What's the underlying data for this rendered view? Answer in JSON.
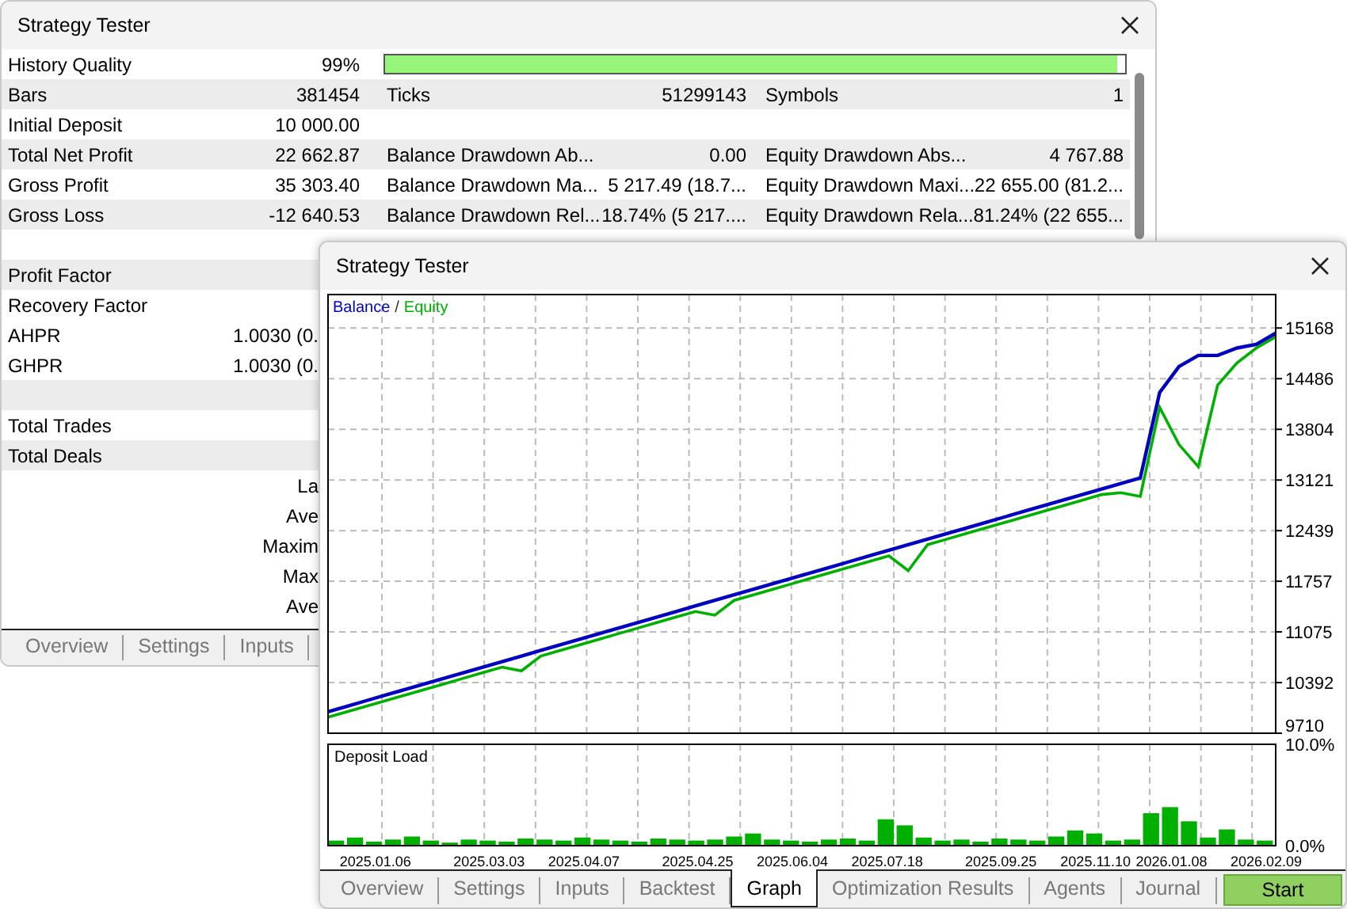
{
  "back_window": {
    "title": "Strategy Tester",
    "rows": [
      {
        "kind": "quality",
        "label": "History Quality",
        "value": "99%",
        "level": 0.99
      },
      {
        "kind": "full",
        "label": "Bars",
        "value": "381454",
        "label2": "Ticks",
        "value2": "51299143",
        "label3": "Symbols",
        "value3": "1"
      },
      {
        "kind": "full",
        "label": "Initial Deposit",
        "value": "10 000.00"
      },
      {
        "kind": "full",
        "label": "Total Net Profit",
        "value": "22 662.87",
        "label2": "Balance Drawdown Ab...",
        "value2": "0.00",
        "label3": "Equity Drawdown Abs...",
        "value3": "4 767.88"
      },
      {
        "kind": "full",
        "label": "Gross Profit",
        "value": "35 303.40",
        "label2": "Balance Drawdown Ma...",
        "value2": "5 217.49 (18.7...",
        "label3": "Equity Drawdown Maxi...",
        "value3": "22 655.00 (81.2..."
      },
      {
        "kind": "full",
        "label": "Gross Loss",
        "value": "-12 640.53",
        "label2": "Balance Drawdown Rel...",
        "value2": "18.74% (5 217....",
        "label3": "Equity Drawdown Rela...",
        "value3": "81.24% (22 655..."
      },
      {
        "kind": "blank"
      },
      {
        "kind": "full",
        "label": "Profit Factor"
      },
      {
        "kind": "full",
        "label": "Recovery Factor"
      },
      {
        "kind": "partial",
        "label": "AHPR",
        "value": "1.0030 (0."
      },
      {
        "kind": "partial",
        "label": "GHPR",
        "value": "1.0030 (0."
      },
      {
        "kind": "blank"
      },
      {
        "kind": "full",
        "label": "Total Trades"
      },
      {
        "kind": "full",
        "label": "Total Deals"
      },
      {
        "kind": "partial",
        "value": "La"
      },
      {
        "kind": "partial",
        "value": "Ave"
      },
      {
        "kind": "partial",
        "value": "Maxim"
      },
      {
        "kind": "partial",
        "value": "Max"
      },
      {
        "kind": "partial",
        "value": "Ave"
      }
    ],
    "tabs": [
      {
        "label": "Overview",
        "selected": false
      },
      {
        "label": "Settings",
        "selected": false
      },
      {
        "label": "Inputs",
        "selected": false
      }
    ]
  },
  "front_window": {
    "title": "Strategy Tester",
    "balance_chart": {
      "legend_separator": "/",
      "chart_data": {
        "type": "line",
        "grid": true,
        "ylim": [
          9710,
          15620
        ],
        "yticks": [
          9710,
          10392,
          11075,
          11757,
          12439,
          13121,
          13804,
          14486,
          15168
        ],
        "categories": [
          null,
          null,
          null,
          null,
          null,
          null,
          null,
          null,
          null,
          null,
          null,
          null,
          null,
          null,
          null,
          null,
          null,
          null,
          null,
          null,
          null,
          null,
          null,
          null,
          null,
          null,
          null,
          null,
          null,
          null,
          null,
          null,
          null,
          null,
          null,
          null,
          null,
          null,
          null,
          null,
          null,
          null,
          null,
          null,
          null,
          null,
          null,
          null,
          null,
          null
        ],
        "series": [
          {
            "name": "Equity",
            "color": "#00b000",
            "values": [
              9925,
              10000,
              10075,
              10150,
              10225,
              10300,
              10375,
              10450,
              10525,
              10600,
              10550,
              10750,
              10825,
              10900,
              10975,
              11050,
              11125,
              11200,
              11275,
              11350,
              11300,
              11500,
              11575,
              11650,
              11725,
              11800,
              11875,
              11950,
              12025,
              12100,
              11900,
              12250,
              12325,
              12400,
              12475,
              12550,
              12625,
              12700,
              12775,
              12850,
              12925,
              12950,
              12900,
              14100,
              13600,
              13300,
              14400,
              14700,
              14900,
              15050
            ]
          },
          {
            "name": "Balance",
            "color": "#0000c0",
            "values": [
              10000,
              10075,
              10150,
              10225,
              10300,
              10375,
              10450,
              10525,
              10600,
              10675,
              10750,
              10825,
              10900,
              10975,
              11050,
              11125,
              11200,
              11275,
              11350,
              11425,
              11500,
              11575,
              11650,
              11725,
              11800,
              11875,
              11950,
              12025,
              12100,
              12175,
              12250,
              12325,
              12400,
              12475,
              12550,
              12625,
              12700,
              12775,
              12850,
              12925,
              13000,
              13075,
              13150,
              14300,
              14650,
              14800,
              14800,
              14900,
              14950,
              15100
            ]
          }
        ]
      }
    },
    "deposit_load": {
      "chart_data": {
        "type": "bar",
        "title": "Deposit Load",
        "grid": true,
        "ylim": [
          0,
          10
        ],
        "yticks": [
          {
            "value": 0,
            "label": "0.0%"
          },
          {
            "value": 10,
            "label": "10.0%"
          }
        ],
        "categories": [
          null,
          null,
          "2025.01.06",
          null,
          null,
          null,
          null,
          null,
          "2025.03.03",
          null,
          null,
          null,
          null,
          "2025.04.07",
          null,
          null,
          null,
          null,
          null,
          "2025.04.25",
          null,
          null,
          null,
          null,
          "2025.06.04",
          null,
          null,
          null,
          null,
          "2025.07.18",
          null,
          null,
          null,
          null,
          null,
          "2025.09.25",
          null,
          null,
          null,
          null,
          "2025.11.10",
          null,
          null,
          null,
          "2026.01.08",
          null,
          null,
          null,
          null,
          "2026.02.09"
        ],
        "series": [
          {
            "color": "#00b000",
            "values": [
              0.5,
              0.8,
              0.4,
              0.6,
              0.9,
              0.5,
              0.3,
              0.6,
              0.5,
              0.4,
              0.7,
              0.6,
              0.5,
              0.8,
              0.6,
              0.5,
              0.4,
              0.7,
              0.6,
              0.5,
              0.6,
              0.9,
              1.2,
              0.6,
              0.5,
              0.4,
              0.6,
              0.7,
              0.5,
              2.6,
              2.0,
              0.8,
              0.5,
              0.6,
              0.4,
              0.7,
              0.6,
              0.5,
              0.9,
              1.5,
              1.2,
              0.5,
              0.6,
              3.2,
              3.8,
              2.4,
              0.8,
              1.6,
              0.6,
              0.5
            ]
          }
        ]
      }
    },
    "tabs": [
      {
        "label": "Overview",
        "selected": false
      },
      {
        "label": "Settings",
        "selected": false
      },
      {
        "label": "Inputs",
        "selected": false
      },
      {
        "label": "Backtest",
        "selected": false
      },
      {
        "label": "Graph",
        "selected": true
      },
      {
        "label": "Optimization Results",
        "selected": false
      },
      {
        "label": "Agents",
        "selected": false
      },
      {
        "label": "Journal",
        "selected": false
      }
    ],
    "start_button": "Start"
  }
}
